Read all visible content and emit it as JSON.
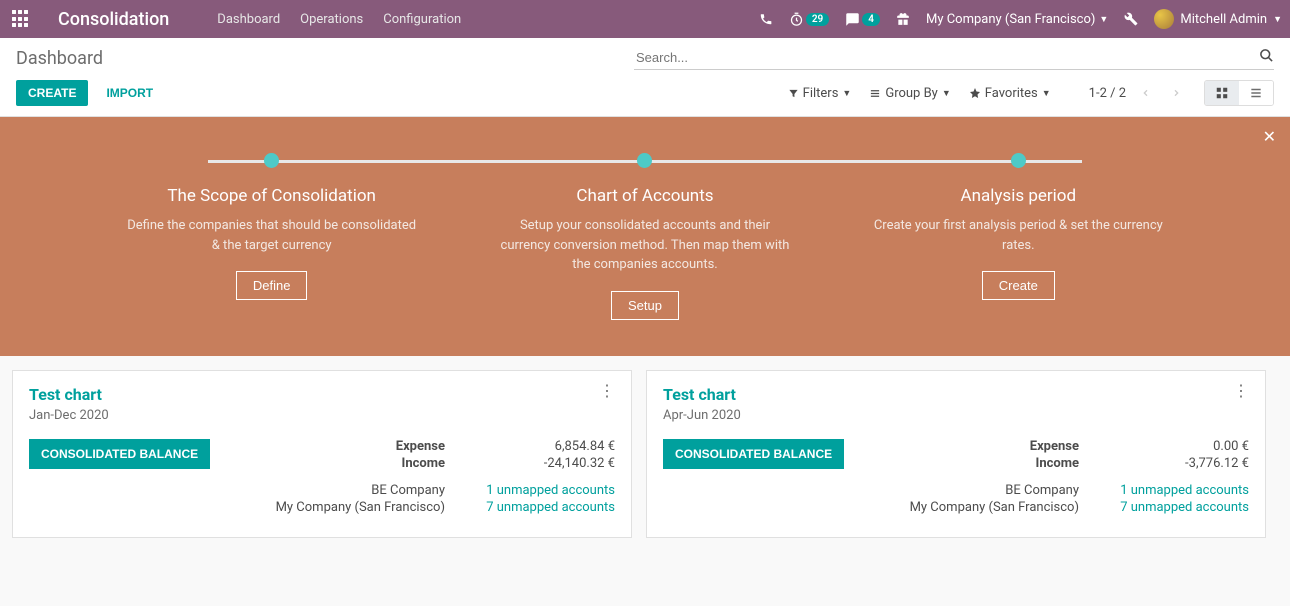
{
  "navbar": {
    "brand": "Consolidation",
    "menu": [
      "Dashboard",
      "Operations",
      "Configuration"
    ],
    "badge_timer": "29",
    "badge_chat": "4",
    "company": "My Company (San Francisco)",
    "user": "Mitchell Admin"
  },
  "control": {
    "breadcrumb": "Dashboard",
    "search_placeholder": "Search...",
    "create": "CREATE",
    "import": "IMPORT",
    "filters": "Filters",
    "groupby": "Group By",
    "favorites": "Favorites",
    "page_range": "1-2 / 2"
  },
  "onboarding": {
    "steps": [
      {
        "title": "The Scope of Consolidation",
        "desc": "Define the companies that should be consolidated & the target currency",
        "btn": "Define"
      },
      {
        "title": "Chart of Accounts",
        "desc": "Setup your consolidated accounts and their currency conversion method. Then map them with the companies accounts.",
        "btn": "Setup"
      },
      {
        "title": "Analysis period",
        "desc": "Create your first analysis period & set the currency rates.",
        "btn": "Create"
      }
    ]
  },
  "cards": [
    {
      "title": "Test chart",
      "period": "Jan-Dec 2020",
      "balance_btn": "CONSOLIDATED BALANCE",
      "lines": [
        {
          "label": "Expense",
          "value": "6,854.84 €",
          "bold": true
        },
        {
          "label": "Income",
          "value": "-24,140.32 €",
          "bold": true
        }
      ],
      "unmapped": [
        {
          "company": "BE Company",
          "link": "1 unmapped accounts"
        },
        {
          "company": "My Company (San Francisco)",
          "link": "7 unmapped accounts"
        }
      ]
    },
    {
      "title": "Test chart",
      "period": "Apr-Jun 2020",
      "balance_btn": "CONSOLIDATED BALANCE",
      "lines": [
        {
          "label": "Expense",
          "value": "0.00 €",
          "bold": true
        },
        {
          "label": "Income",
          "value": "-3,776.12 €",
          "bold": true
        }
      ],
      "unmapped": [
        {
          "company": "BE Company",
          "link": "1 unmapped accounts"
        },
        {
          "company": "My Company (San Francisco)",
          "link": "7 unmapped accounts"
        }
      ]
    }
  ]
}
